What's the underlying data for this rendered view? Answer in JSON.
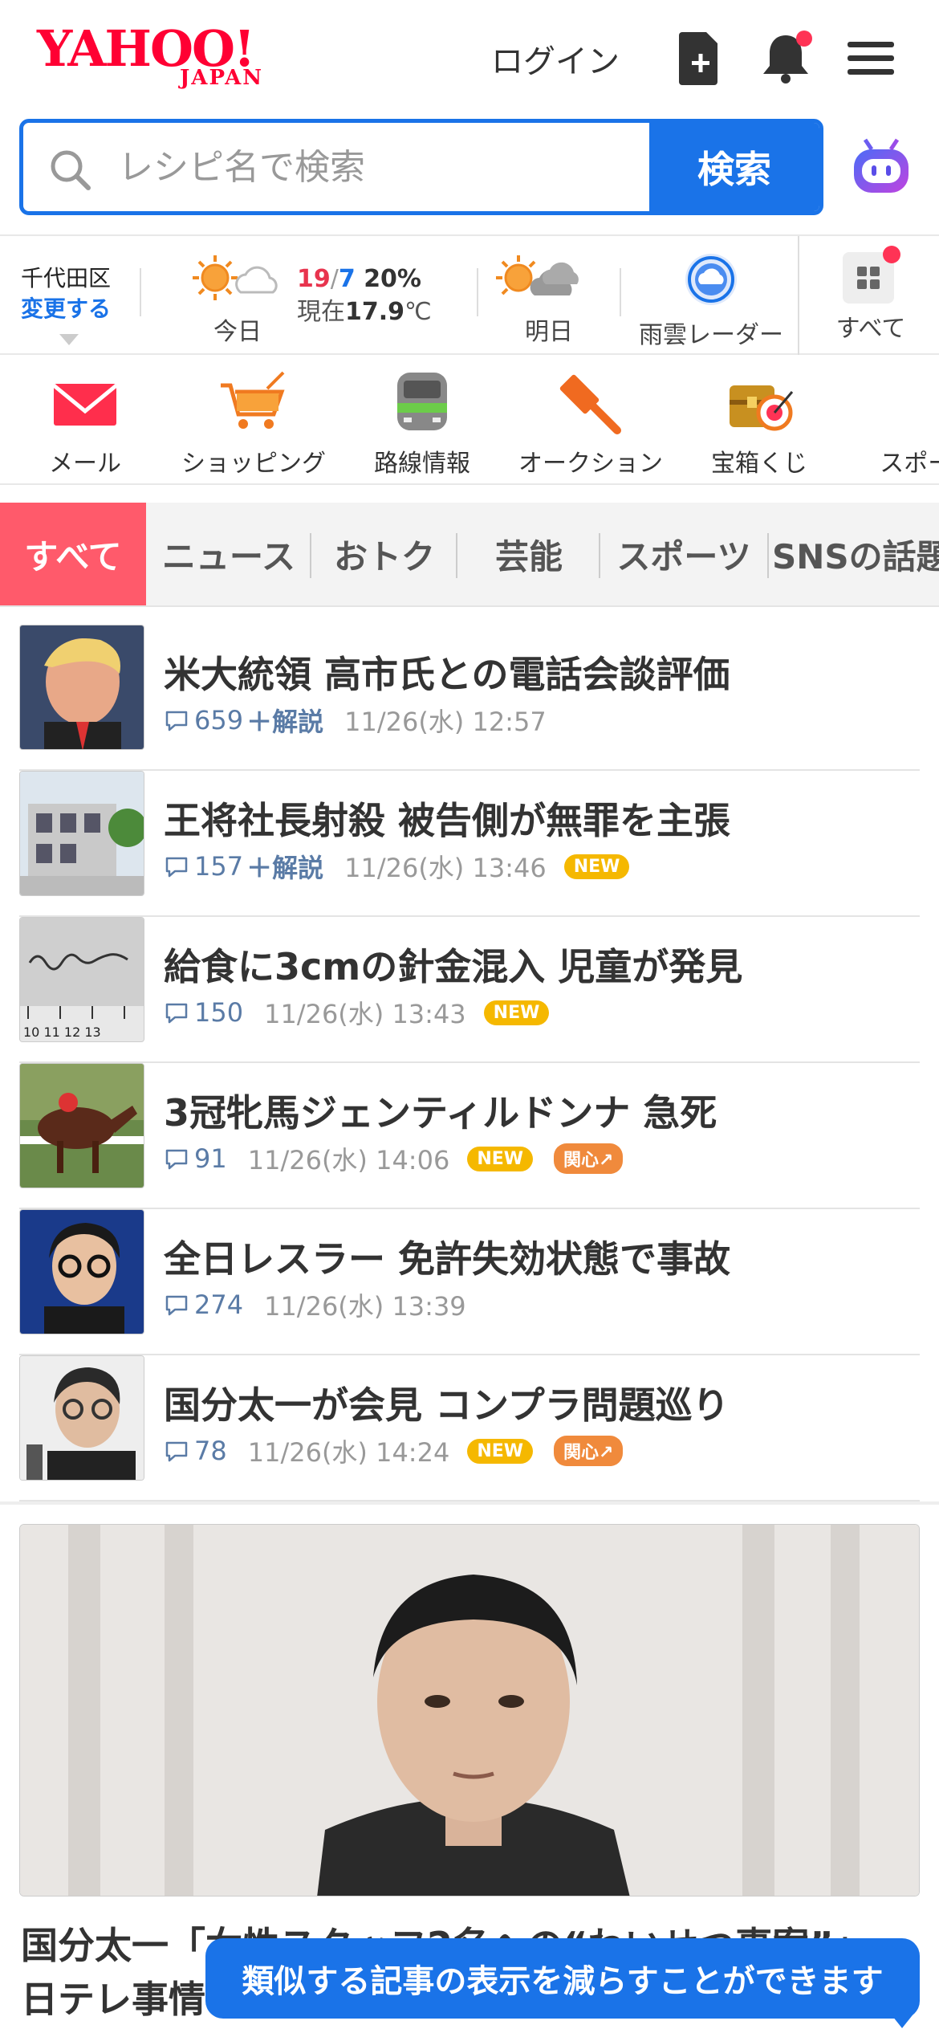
{
  "header": {
    "logo_main": "YAHOO!",
    "logo_sub": "JAPAN",
    "login_label": "ログイン",
    "icons": [
      "add-document-icon",
      "bell-icon",
      "hamburger-menu-icon"
    ]
  },
  "search": {
    "placeholder": "レシピ名で検索",
    "button_label": "検索"
  },
  "weather": {
    "area": "千代田区",
    "change_label": "変更する",
    "today_label": "今日",
    "high": "19",
    "low": "7",
    "precip": "20%",
    "now_label": "現在",
    "now_temp": "17.9",
    "unit": "℃",
    "tomorrow_label": "明日",
    "radar_label": "雨雲レーダー",
    "all_label": "すべて"
  },
  "services": [
    {
      "label": "メール",
      "icon": "mail-icon"
    },
    {
      "label": "ショッピング",
      "icon": "shopping-cart-icon"
    },
    {
      "label": "路線情報",
      "icon": "train-icon"
    },
    {
      "label": "オークション",
      "icon": "auction-hammer-icon"
    },
    {
      "label": "宝箱くじ",
      "icon": "treasure-box-icon"
    },
    {
      "label": "スポーツ",
      "icon": "sports-icon"
    }
  ],
  "tabs": [
    {
      "label": "すべて",
      "active": true
    },
    {
      "label": "ニュース"
    },
    {
      "label": "おトク"
    },
    {
      "label": "芸能"
    },
    {
      "label": "スポーツ"
    },
    {
      "label": "SNSの話題"
    }
  ],
  "news": [
    {
      "title": "米大統領 高市氏との電話会談評価",
      "comments": "659",
      "extra": "＋解説",
      "date": "11/26(水) 12:57",
      "new": false,
      "hot": false
    },
    {
      "title": "王将社長射殺 被告側が無罪を主張",
      "comments": "157",
      "extra": "＋解説",
      "date": "11/26(水) 13:46",
      "new": true,
      "hot": false
    },
    {
      "title": "給食に3cmの針金混入 児童が発見",
      "comments": "150",
      "extra": "",
      "date": "11/26(水) 13:43",
      "new": true,
      "hot": false
    },
    {
      "title": "3冠牝馬ジェンティルドンナ 急死",
      "comments": "91",
      "extra": "",
      "date": "11/26(水) 14:06",
      "new": true,
      "hot": true
    },
    {
      "title": "全日レスラー 免許失効状態で事故",
      "comments": "274",
      "extra": "",
      "date": "11/26(水) 13:39",
      "new": false,
      "hot": false
    },
    {
      "title": "国分太一が会見 コンプラ問題巡り",
      "comments": "78",
      "extra": "",
      "date": "11/26(水) 14:24",
      "new": true,
      "hot": true
    }
  ],
  "badges": {
    "new": "NEW",
    "hot": "関心↗"
  },
  "featured": {
    "title_line1": "国分太一「女性スタッフ2名への“わいせつ事案”」",
    "title_line2": "日テレ事情"
  },
  "toast": "類似する記事の表示を減らすことができます",
  "colors": {
    "brand_red": "#ff0033",
    "accent_blue": "#1a73e8",
    "tab_active": "#ff5a6b"
  }
}
